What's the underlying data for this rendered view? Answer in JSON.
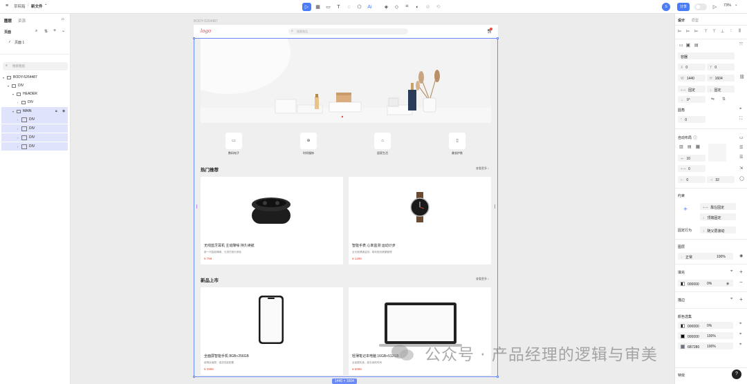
{
  "topbar": {
    "app_label": "草稿箱",
    "separator": "/",
    "file_name": "新文件",
    "file_caret": "⌄",
    "share_label": "分享",
    "zoom": "73%",
    "user_initial": "S"
  },
  "left_panel": {
    "tab_layers": "图层",
    "tab_assets": "资源",
    "pages_label": "页面",
    "page_1": "页面 1",
    "search_placeholder": "搜索图层",
    "tree": [
      {
        "label": "BODY-5264487"
      },
      {
        "label": "DIV"
      },
      {
        "label": "HEADER"
      },
      {
        "label": "DIV"
      },
      {
        "label": "MAIN"
      },
      {
        "label": "DIV"
      },
      {
        "label": "DIV"
      },
      {
        "label": "DIV"
      },
      {
        "label": "DIV"
      }
    ]
  },
  "canvas": {
    "artboard_label": "BODY-5264487",
    "size_label": "1440 × 1604"
  },
  "site": {
    "logo": "logo",
    "search_placeholder": "搜索商品",
    "categories": [
      {
        "label": "数码电子"
      },
      {
        "label": "时尚服饰"
      },
      {
        "label": "居家生活"
      },
      {
        "label": "美妆护肤"
      }
    ],
    "section_hot": "热门推荐",
    "section_new": "新品上市",
    "more_label": "查看更多 ›",
    "hot_products": [
      {
        "name": "无线蓝牙耳机 主动降噪 持久续航",
        "desc": "新一代智能降噪，沉浸式音乐体验",
        "price": "¥ 799"
      },
      {
        "name": "智能手表 心率监测 运动计步",
        "desc": "全天候健康监测，助你规划健康管理",
        "price": "¥ 1299"
      }
    ],
    "new_products": [
      {
        "name": "全面屏智能手机 8GB+256GB",
        "desc": "超清全面屏，强劲性能配置",
        "price": "¥ 2999"
      },
      {
        "name": "轻薄笔记本电脑 16GB+512GB",
        "desc": "全金属机身，超长续航时间",
        "price": "¥ 5999"
      }
    ]
  },
  "right_panel": {
    "tab_design": "设计",
    "tab_prototype": "原型",
    "frame_type": "容器",
    "x_label": "X",
    "x_value": "0",
    "y_label": "Y",
    "y_value": "0",
    "w_label": "W",
    "w_value": "1440",
    "h_label": "H",
    "h_value": "1604",
    "fixed_label": "固定",
    "rotation_value": "0°",
    "radius_section": "圆角",
    "radius_value": "0",
    "autolayout_section": "自动布局",
    "gap_value": "10",
    "pad_value": "0",
    "pad2_value": "0",
    "pad3_value": "0",
    "pad4_value": "32",
    "constraints_section": "约束",
    "constraint_h": "靠左固定",
    "constraint_v": "顶端固定",
    "fixed_behavior_label": "固定行为",
    "fixed_behavior_value": "随父层滚动",
    "layer_section": "图层",
    "blend_mode": "正常",
    "opacity": "100%",
    "fill_section": "填充",
    "fill_hex": "000000",
    "fill_opacity": "0%",
    "stroke_section": "描边",
    "selection_colors_section": "颜色选集",
    "colors": [
      {
        "hex": "000000",
        "pct": "0%"
      },
      {
        "hex": "000000",
        "pct": "100%"
      },
      {
        "hex": "6B7280",
        "pct": "100%"
      }
    ],
    "effects_section": "特效"
  },
  "watermark": "公众号 · 产品经理的逻辑与审美",
  "colors": {
    "accent": "#4a7cf6",
    "price": "#e84b3a",
    "logo": "#e0424a",
    "selection": "#dfe3fb"
  }
}
